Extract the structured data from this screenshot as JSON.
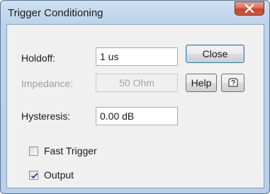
{
  "window": {
    "title": "Trigger Conditioning",
    "close_icon": "close-x-icon"
  },
  "fields": {
    "holdoff": {
      "label": "Holdoff:",
      "value": "1 us"
    },
    "impedance": {
      "label": "Impedance:",
      "value": "50 Ohm",
      "enabled": false
    },
    "hysteresis": {
      "label": "Hysteresis:",
      "value": "0.00 dB"
    }
  },
  "buttons": {
    "close_label": "Close",
    "help_label": "Help",
    "context_help_icon": "context-help-icon"
  },
  "checkboxes": {
    "fast_trigger": {
      "label": "Fast Trigger",
      "checked": false
    },
    "output": {
      "label": "Output",
      "checked": true
    }
  },
  "colors": {
    "title_bar": "#bcd3ea",
    "close_button": "#c6432c",
    "dialog_background": "#f0f0f0",
    "disabled_text": "#a0a0a0"
  }
}
